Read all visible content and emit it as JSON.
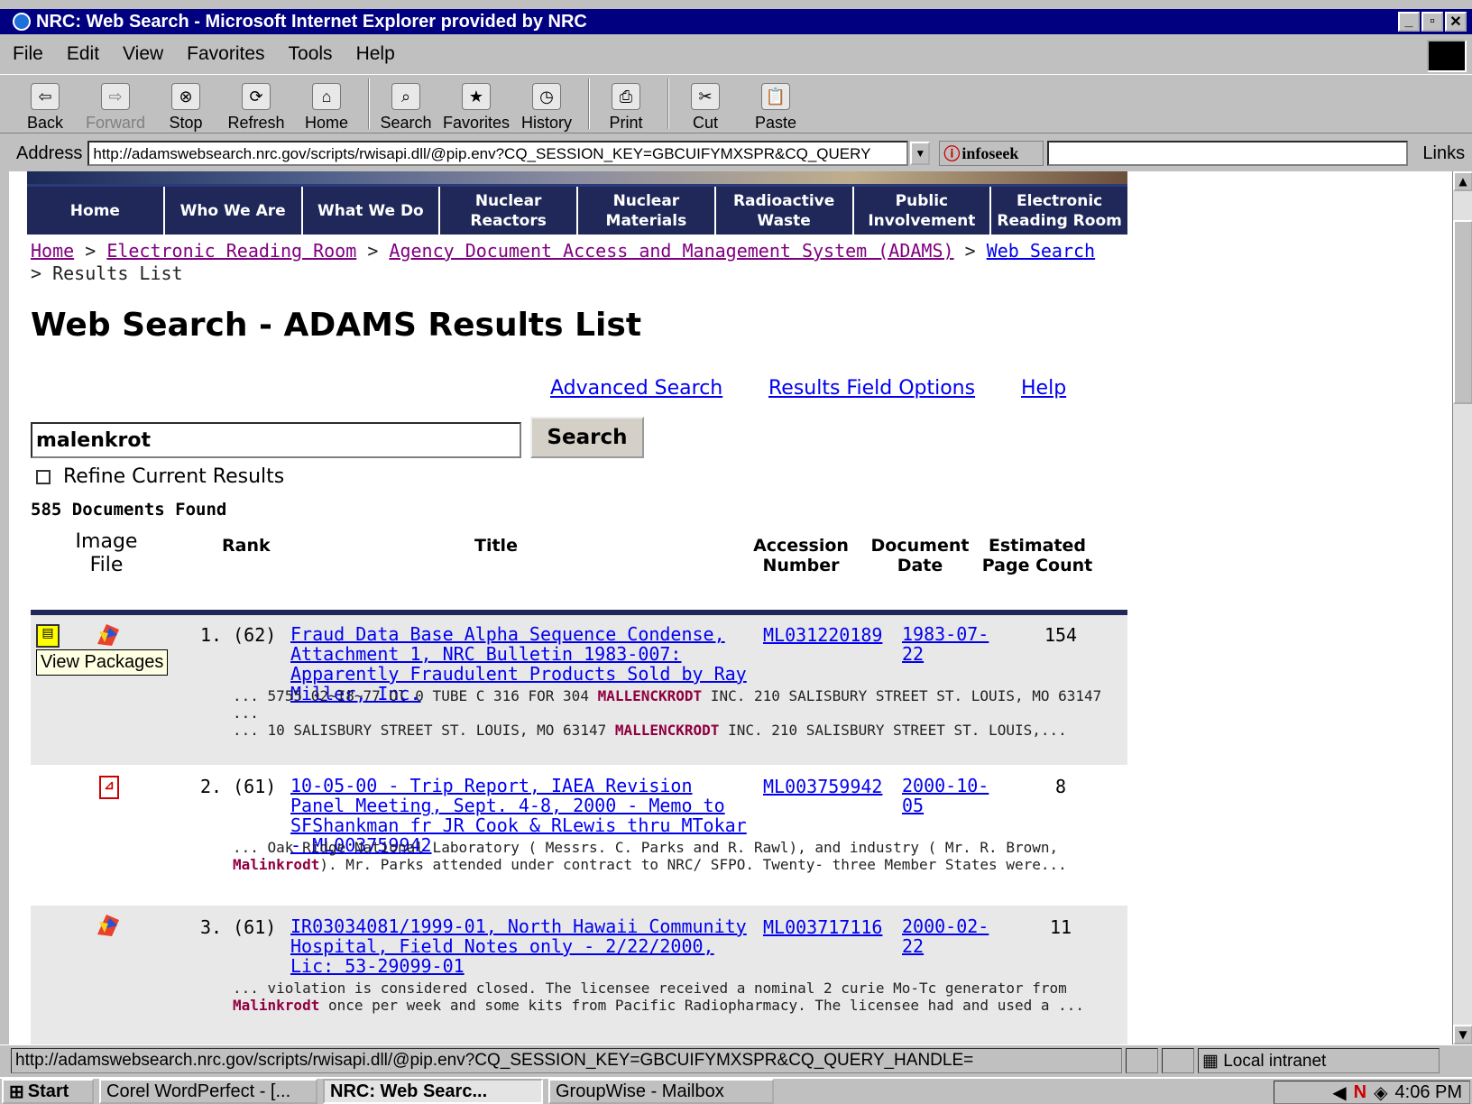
{
  "window": {
    "title": "NRC: Web Search - Microsoft Internet Explorer provided by NRC"
  },
  "menu": [
    "File",
    "Edit",
    "View",
    "Favorites",
    "Tools",
    "Help"
  ],
  "toolbar": [
    {
      "label": "Back",
      "icon": "back-arrow-icon"
    },
    {
      "label": "Forward",
      "icon": "forward-arrow-icon"
    },
    {
      "label": "Stop",
      "icon": "stop-icon"
    },
    {
      "label": "Refresh",
      "icon": "refresh-icon"
    },
    {
      "label": "Home",
      "icon": "home-icon"
    },
    {
      "label": "Search",
      "icon": "search-icon"
    },
    {
      "label": "Favorites",
      "icon": "favorites-icon"
    },
    {
      "label": "History",
      "icon": "history-icon"
    },
    {
      "label": "Print",
      "icon": "print-icon"
    },
    {
      "label": "Cut",
      "icon": "cut-icon"
    },
    {
      "label": "Paste",
      "icon": "paste-icon"
    }
  ],
  "address": {
    "label": "Address",
    "url": "http://adamswebsearch.nrc.gov/scripts/rwisapi.dll/@pip.env?CQ_SESSION_KEY=GBCUIFYMXSPR&CQ_QUERY",
    "infoseek": "infoseek",
    "links": "Links"
  },
  "nav": [
    "Home",
    "Who We Are",
    "What We Do",
    "Nuclear Reactors",
    "Nuclear Materials",
    "Radioactive Waste",
    "Public Involvement",
    "Electronic Reading Room"
  ],
  "breadcrumb": {
    "home": "Home",
    "err": "Electronic Reading Room",
    "adams": "Agency Document Access and Management System (ADAMS)",
    "web": "Web Search",
    "current": "Results List",
    "sep": ">"
  },
  "page": {
    "title": "Web Search - ADAMS Results List",
    "advanced": "Advanced Search",
    "fields": "Results Field Options",
    "help": "Help",
    "query": "malenkrot",
    "search_button": "Search",
    "refine": "Refine Current Results",
    "found": "585 Documents Found",
    "tooltip": "View Packages"
  },
  "table": {
    "headers": {
      "image": "Image File",
      "rank": "Rank",
      "title": "Title",
      "accession": "Accession Number",
      "date": "Document Date",
      "pages": "Estimated Page Count"
    },
    "rows": [
      {
        "num": "1.",
        "score": "(62)",
        "title": "Fraud Data Base Alpha Sequence Condense, Attachment 1, NRC Bulletin 1983-007: Apparently Fraudulent Products Sold by Ray Miller, Inc.",
        "acc": "ML031220189",
        "date": "1983-07-22",
        "pages": "154",
        "snip1a": "... 5755 02~I8~77 Ol 0 TUBE C 316 FOR 304 ",
        "hl1": "MALLENCKRODT",
        "snip1b": " INC. 210 SALISBURY STREET ST. LOUIS, MO 63147 ...",
        "snip2a": "... 10 SALISBURY STREET ST. LOUIS, MO 63147 ",
        "hl2": "MALLENCKRODT",
        "snip2b": " INC. 210 SALISBURY STREET ST. LOUIS,..."
      },
      {
        "num": "2.",
        "score": "(61)",
        "title": "10-05-00 - Trip Report, IAEA Revision Panel Meeting, Sept. 4-8, 2000 - Memo to SFShankman fr JR Cook & RLewis thru MTokar - ML003759942",
        "acc": "ML003759942",
        "date": "2000-10-05",
        "pages": "8",
        "snip1a": "... Oak Ridge National Laboratory ( Messrs. C. Parks and R. Rawl), and industry ( Mr. R. Brown, ",
        "hl1": "Malinkrodt",
        "snip1b": "). Mr. Parks attended under contract to NRC/ SFPO. Twenty- three Member States were..."
      },
      {
        "num": "3.",
        "score": "(61)",
        "title": "IR03034081/1999-01, North Hawaii Community Hospital, Field Notes only - 2/22/2000, Lic: 53-29099-01",
        "acc": "ML003717116",
        "date": "2000-02-22",
        "pages": "11",
        "snip1a": "... violation is considered closed. The licensee received a nominal 2 curie Mo-Tc generator from ",
        "hl1": "Malinkrodt",
        "snip1b": " once per week and some kits from Pacific Radiopharmacy. The licensee had and used a ..."
      }
    ]
  },
  "status": {
    "url": "http://adamswebsearch.nrc.gov/scripts/rwisapi.dll/@pip.env?CQ_SESSION_KEY=GBCUIFYMXSPR&CQ_QUERY_HANDLE=",
    "zone": "Local intranet"
  },
  "taskbar": {
    "start": "Start",
    "tasks": [
      "Corel WordPerfect - [...",
      "NRC: Web Searc...",
      "GroupWise - Mailbox"
    ],
    "clock": "4:06 PM"
  }
}
